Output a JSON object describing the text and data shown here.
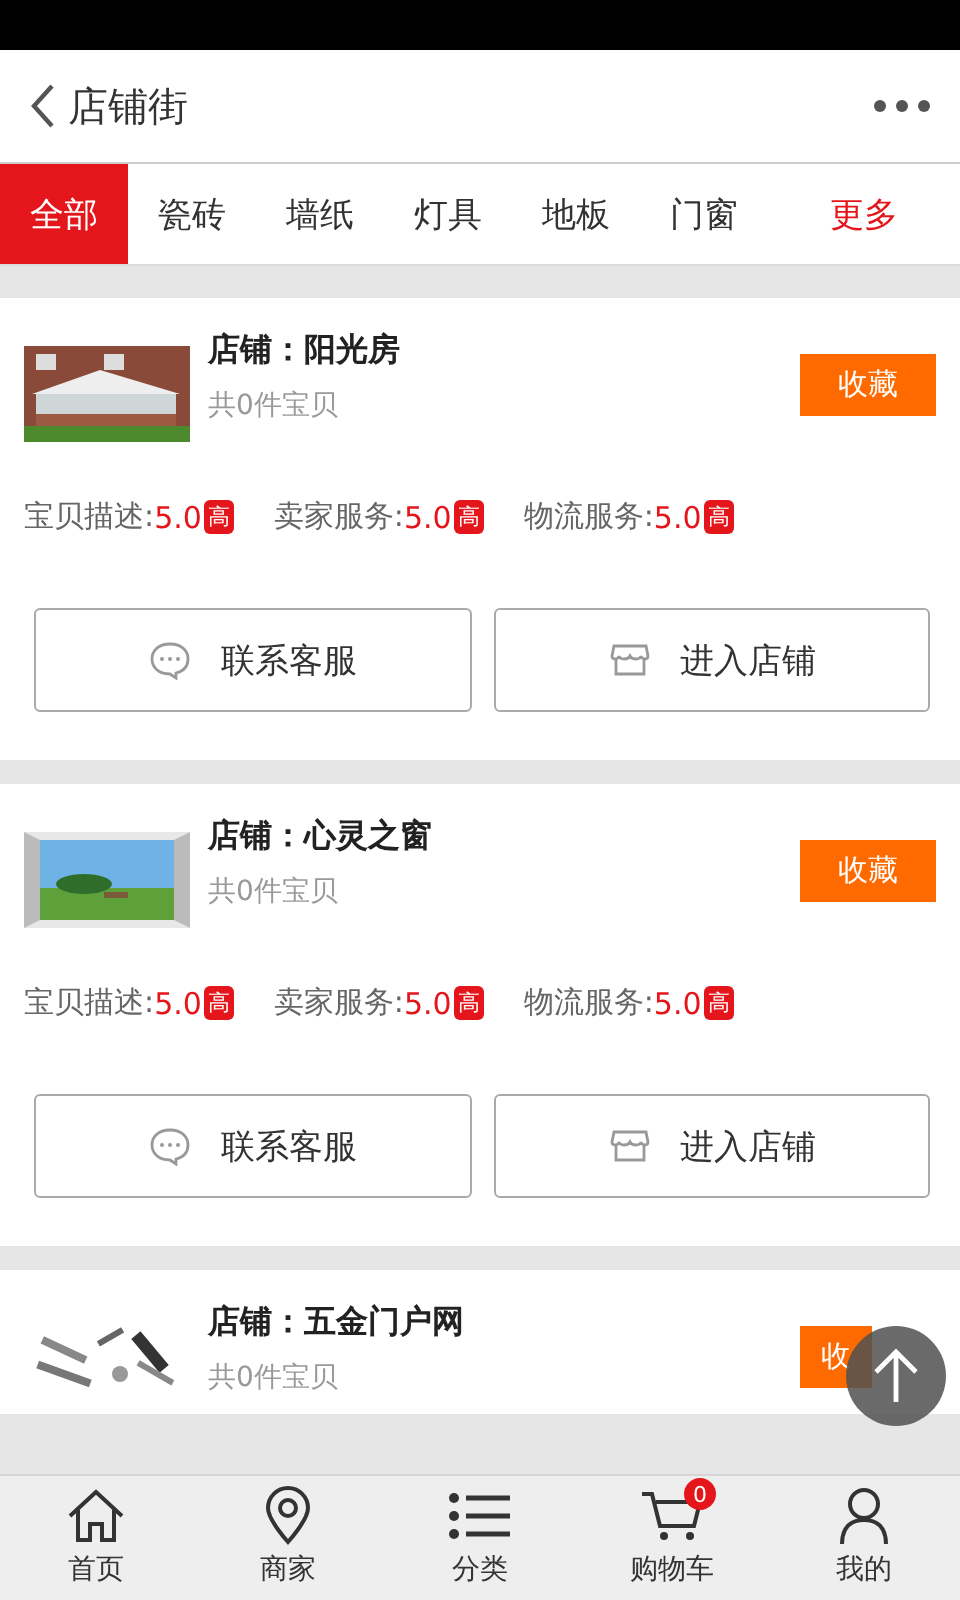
{
  "header": {
    "title": "店铺街"
  },
  "tabs": [
    {
      "label": "全部",
      "selected": true
    },
    {
      "label": "瓷砖",
      "selected": false
    },
    {
      "label": "墙纸",
      "selected": false
    },
    {
      "label": "灯具",
      "selected": false
    },
    {
      "label": "地板",
      "selected": false
    },
    {
      "label": "门窗",
      "selected": false
    }
  ],
  "more": "更多",
  "shops": [
    {
      "name": "店铺：阳光房",
      "count": "共0件宝贝",
      "favorite": "收藏",
      "ratings": [
        {
          "label": "宝贝描述:",
          "score": "5.0",
          "badge": "高"
        },
        {
          "label": "卖家服务:",
          "score": "5.0",
          "badge": "高"
        },
        {
          "label": "物流服务:",
          "score": "5.0",
          "badge": "高"
        }
      ],
      "actions": [
        "联系客服",
        "进入店铺"
      ]
    },
    {
      "name": "店铺：心灵之窗",
      "count": "共0件宝贝",
      "favorite": "收藏",
      "ratings": [
        {
          "label": "宝贝描述:",
          "score": "5.0",
          "badge": "高"
        },
        {
          "label": "卖家服务:",
          "score": "5.0",
          "badge": "高"
        },
        {
          "label": "物流服务:",
          "score": "5.0",
          "badge": "高"
        }
      ],
      "actions": [
        "联系客服",
        "进入店铺"
      ]
    },
    {
      "name": "店铺：五金门户网",
      "count": "共0件宝贝",
      "favorite": "收"
    }
  ],
  "nav": [
    {
      "label": "首页"
    },
    {
      "label": "商家"
    },
    {
      "label": "分类"
    },
    {
      "label": "购物车",
      "badge": "0"
    },
    {
      "label": "我的"
    }
  ]
}
